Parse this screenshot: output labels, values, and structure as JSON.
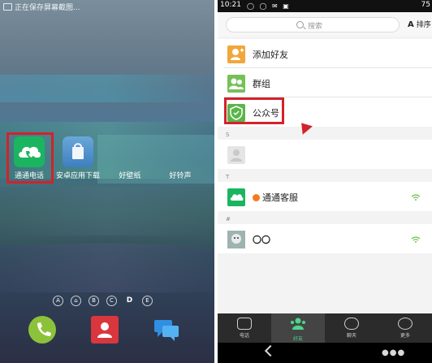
{
  "home": {
    "status_text": "正在保存屏幕截图...",
    "apps": [
      {
        "label": "通通电话"
      },
      {
        "label": "安卓应用下载"
      },
      {
        "label": "好壁纸"
      },
      {
        "label": "好铃声"
      }
    ],
    "index_letters": [
      "A",
      "⌂",
      "B",
      "C",
      "D",
      "E"
    ],
    "selected_letter": "D"
  },
  "phone": {
    "status": {
      "time": "10:21",
      "battery": "75"
    },
    "search_placeholder": "搜索",
    "sort_label": "排序",
    "sort_glyph": "A",
    "entries": [
      {
        "name": "添加好友",
        "icon": "add-friend-icon"
      },
      {
        "name": "群组",
        "icon": "group-icon"
      },
      {
        "name": "公众号",
        "icon": "shield-check-icon"
      }
    ],
    "sections": [
      "S",
      "T",
      "#"
    ],
    "contacts": [
      {
        "name": "",
        "icon": "avatar-placeholder-icon"
      },
      {
        "name": "通通客服",
        "icon": "tongtong-icon",
        "verified": true
      },
      {
        "name": "〇〇",
        "icon": "photo-avatar-icon"
      }
    ],
    "tabs": [
      {
        "label": "电话",
        "icon": "dialpad-icon"
      },
      {
        "label": "好友",
        "icon": "friends-icon",
        "active": true
      },
      {
        "label": "聊天",
        "icon": "chat-icon"
      },
      {
        "label": "更多",
        "icon": "more-icon"
      }
    ]
  },
  "colors": {
    "highlight_red": "#d3222a",
    "brand_green": "#1bb560",
    "active_tab_green": "#4cd68c"
  }
}
